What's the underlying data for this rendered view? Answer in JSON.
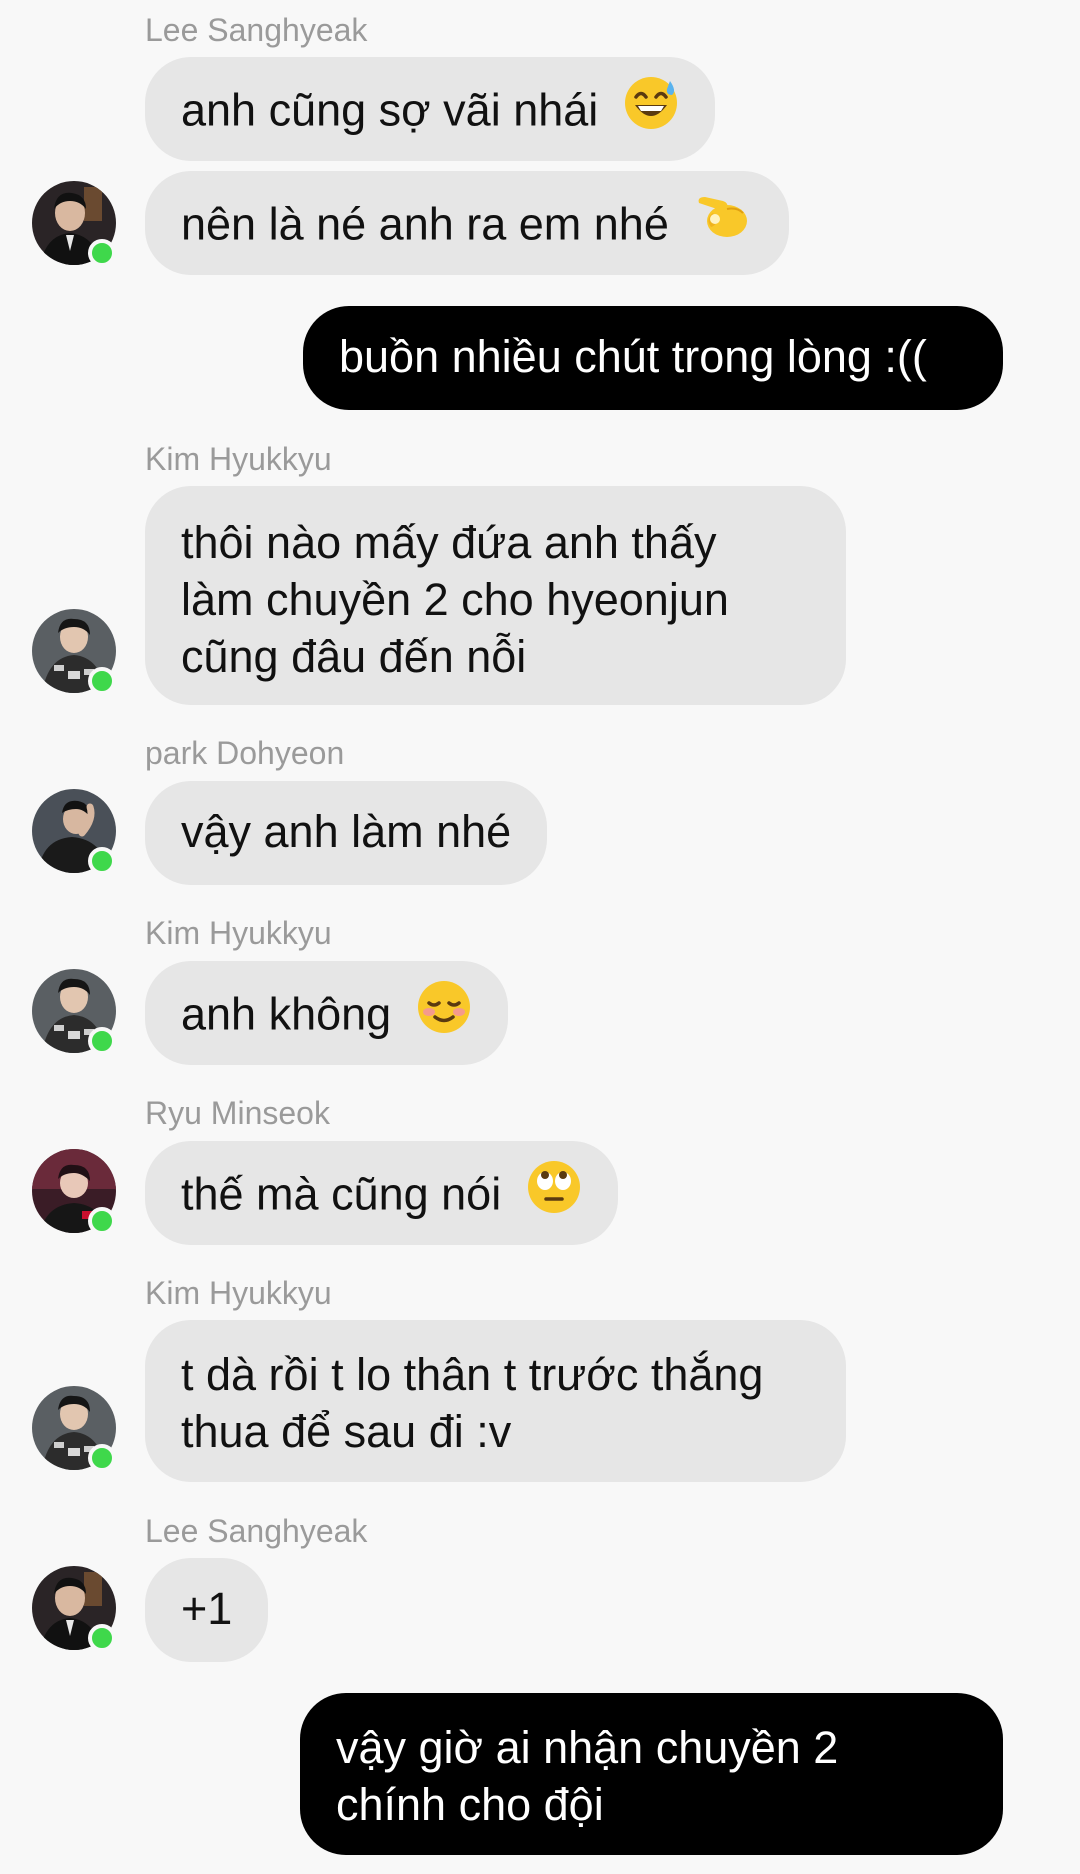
{
  "messages": [
    {
      "sender": "Lee Sanghyeak",
      "text": "anh cũng sợ vãi nhái",
      "emoji": "grinning-sweat-emoji"
    },
    {
      "text": "nên là né anh ra em nhé",
      "emoji": "pinching-hand-emoji"
    },
    {
      "text": "buồn nhiều chút trong lòng :(("
    },
    {
      "sender": "Kim Hyukkyu",
      "lines": [
        "thôi nào mấy đứa anh thấy",
        "làm chuyền 2 cho hyeonjun",
        "cũng đâu đến nỗi"
      ]
    },
    {
      "sender": "park Dohyeon",
      "text": "vậy anh làm nhé"
    },
    {
      "sender": "Kim Hyukkyu",
      "text": "anh không",
      "emoji": "smiling-blush-emoji"
    },
    {
      "sender": "Ryu Minseok",
      "text": "thế mà cũng nói",
      "emoji": "eye-roll-emoji"
    },
    {
      "sender": "Kim Hyukkyu",
      "lines": [
        "t dà rồi t lo thân t trước thắng",
        "thua để sau đi :v"
      ]
    },
    {
      "sender": "Lee Sanghyeak",
      "text": "+1"
    },
    {
      "lines": [
        "vậy giờ ai nhận chuyền 2",
        "chính cho đội"
      ]
    }
  ],
  "status_color": "#3fd84b",
  "outgoing_bubble_color": "#000000",
  "incoming_bubble_color": "#e6e6e6"
}
